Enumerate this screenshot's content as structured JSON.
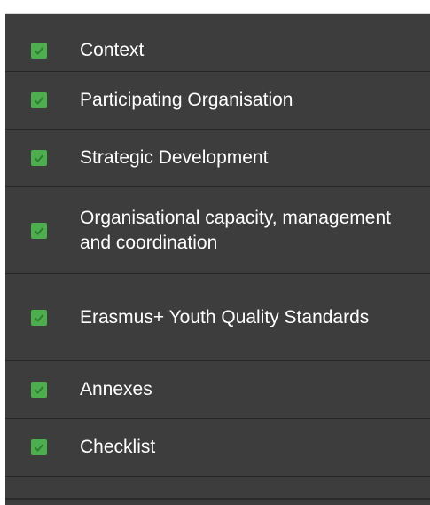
{
  "sidebar": {
    "items": [
      {
        "label": "Context",
        "checked": true,
        "check_icon": "check-icon"
      },
      {
        "label": "Participating Organisation",
        "checked": true,
        "check_icon": "check-icon"
      },
      {
        "label": "Strategic Development",
        "checked": true,
        "check_icon": "check-icon"
      },
      {
        "label": "Organisational capacity, management and coordination",
        "checked": true,
        "check_icon": "check-icon"
      },
      {
        "label": "Erasmus+ Youth Quality Standards",
        "checked": true,
        "check_icon": "check-icon"
      },
      {
        "label": "Annexes",
        "checked": true,
        "check_icon": "check-icon"
      },
      {
        "label": "Checklist",
        "checked": true,
        "check_icon": "check-icon"
      }
    ]
  },
  "colors": {
    "panel_background": "#3d3d3d",
    "check_green": "#4cae4c",
    "text": "#ffffff",
    "divider": "#262626"
  }
}
